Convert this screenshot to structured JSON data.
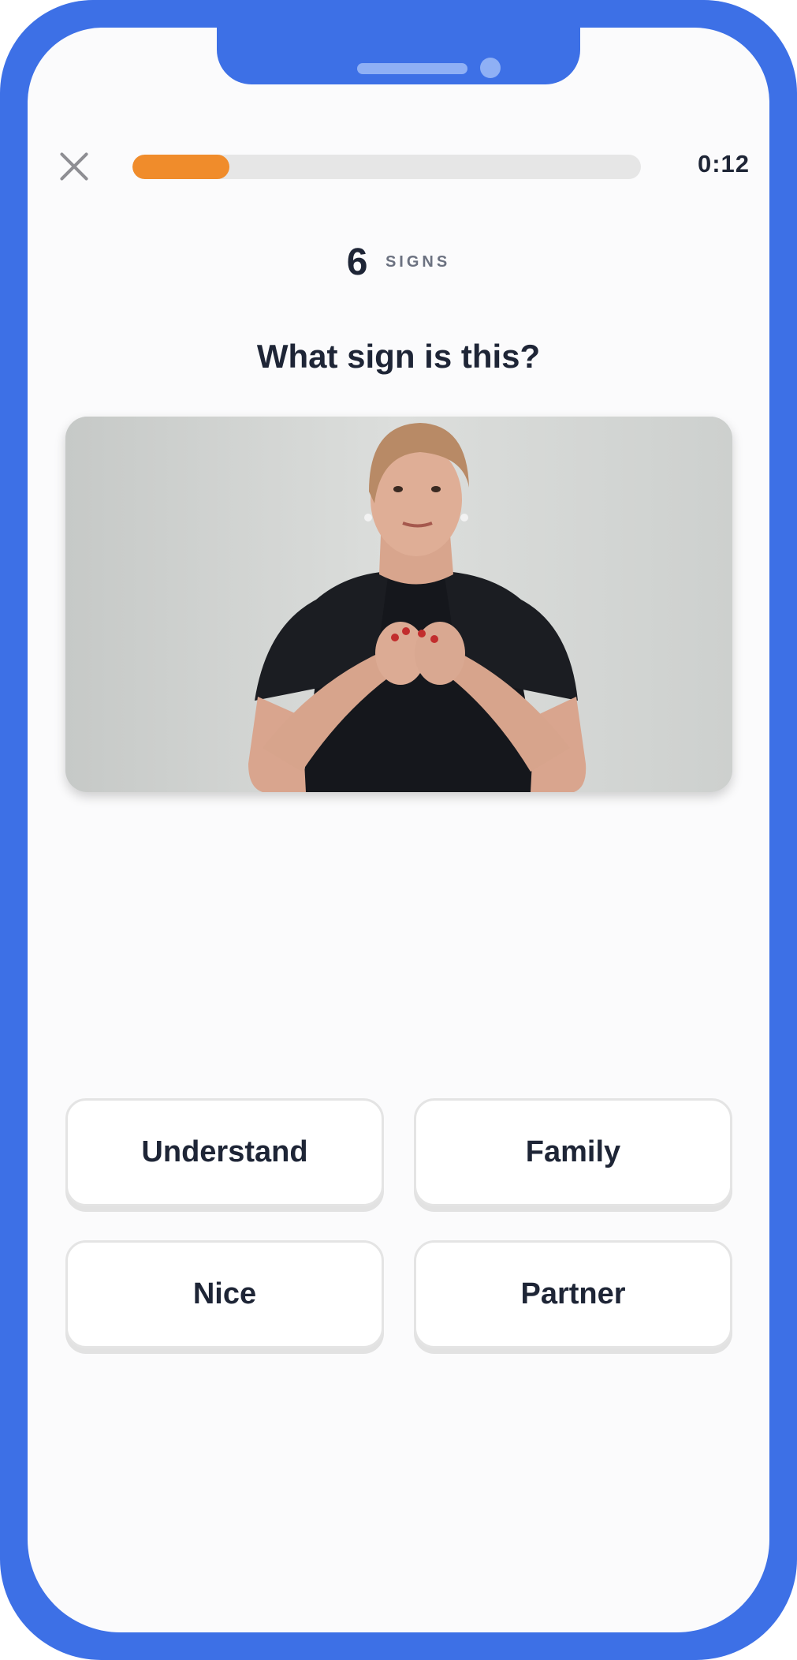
{
  "header": {
    "close_icon": "close-icon",
    "progress": 0.19,
    "timer": "0:12"
  },
  "counter": {
    "count": "6",
    "label": "SIGNS"
  },
  "question": "What sign is this?",
  "video": {
    "content": "sign-language-video"
  },
  "answers": [
    {
      "label": "Understand"
    },
    {
      "label": "Family"
    },
    {
      "label": "Nice"
    },
    {
      "label": "Partner"
    }
  ],
  "colors": {
    "frame": "#3d70e6",
    "progress": "#f08c2b",
    "text": "#1e2536"
  }
}
